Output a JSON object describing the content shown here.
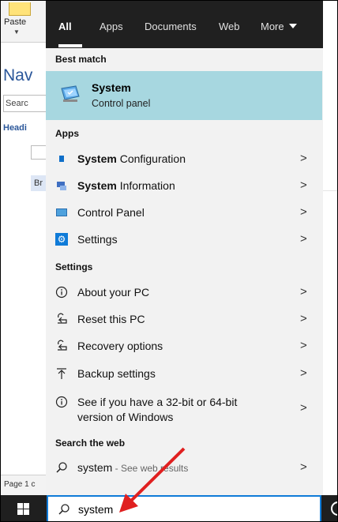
{
  "background": {
    "paste_label": "Paste",
    "nav_title": "Nav",
    "nav_search_text": "Searc",
    "heading_text": "Headi",
    "br_text": "Br",
    "page_text": "Page 1 c"
  },
  "tabs": [
    {
      "label": "All",
      "active": true
    },
    {
      "label": "Apps",
      "active": false
    },
    {
      "label": "Documents",
      "active": false
    },
    {
      "label": "Web",
      "active": false
    },
    {
      "label": "More",
      "active": false
    }
  ],
  "best_match": {
    "heading": "Best match",
    "title": "System",
    "subtitle": "Control panel",
    "icon": "system-monitor-icon"
  },
  "apps": {
    "heading": "Apps",
    "items": [
      {
        "bold": "System",
        "rest": " Configuration",
        "icon": "system-configuration-icon"
      },
      {
        "bold": "System",
        "rest": " Information",
        "icon": "system-information-icon"
      },
      {
        "bold": "",
        "rest": "Control Panel",
        "icon": "control-panel-icon"
      },
      {
        "bold": "",
        "rest": "Settings",
        "icon": "settings-gear-icon"
      }
    ]
  },
  "settings": {
    "heading": "Settings",
    "items": [
      {
        "label": "About your PC",
        "icon": "info-icon"
      },
      {
        "label": "Reset this PC",
        "icon": "reset-icon"
      },
      {
        "label": "Recovery options",
        "icon": "recovery-icon"
      },
      {
        "label": "Backup settings",
        "icon": "backup-upload-icon"
      },
      {
        "label_line1": "See if you have a 32-bit or 64-bit",
        "label_line2": "version of Windows",
        "icon": "info-icon"
      }
    ]
  },
  "web": {
    "heading": "Search the web",
    "query": "system",
    "suffix": " - See web results"
  },
  "taskbar": {
    "search_value": "system"
  },
  "colors": {
    "tabbar": "#202020",
    "best_match_highlight": "#a7d7e0",
    "accent": "#0f7bd8",
    "annotation": "#e02020"
  }
}
